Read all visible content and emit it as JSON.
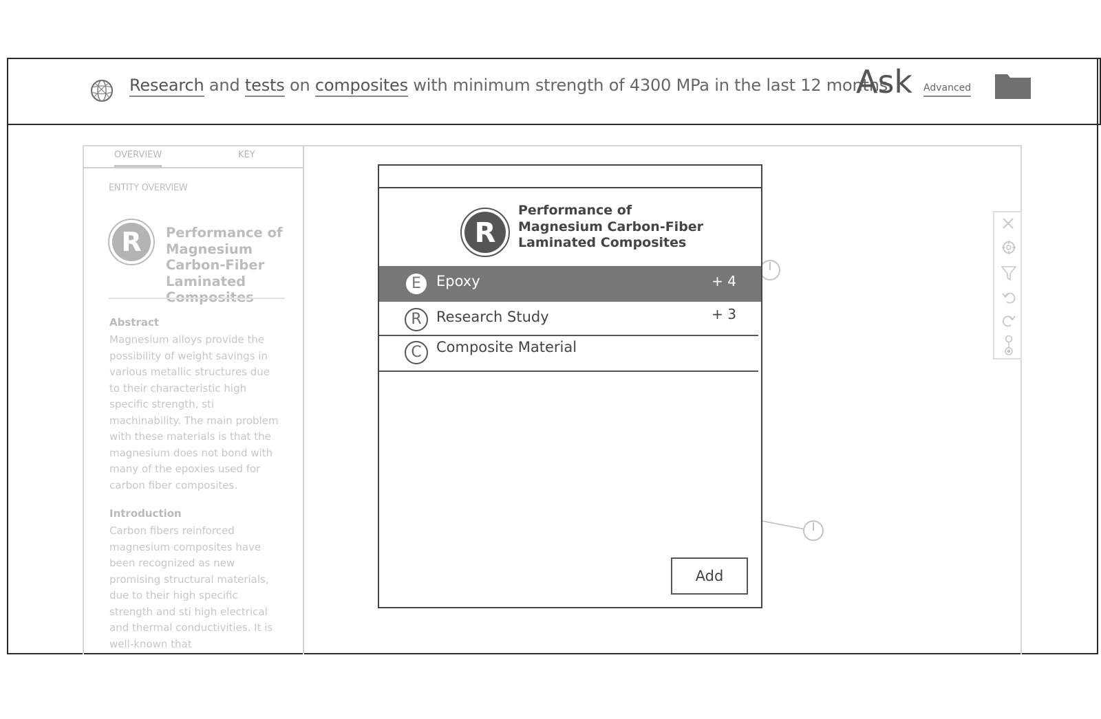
{
  "query": {
    "parts": [
      {
        "text": "Research",
        "keyword": true
      },
      {
        "text": " and ",
        "keyword": false
      },
      {
        "text": "tests",
        "keyword": true
      },
      {
        "text": " on ",
        "keyword": false
      },
      {
        "text": "composites",
        "keyword": true
      },
      {
        "text": " with minimum strength of 4300 MPa in the last 12 months",
        "keyword": false
      }
    ],
    "ask_label": "Ask",
    "advanced_label": "Advanced"
  },
  "left_panel": {
    "tabs": [
      "OVERVIEW",
      "KEY"
    ],
    "section_label": "ENTITY OVERVIEW",
    "entity_letter": "R",
    "entity_title": "Performance of Magnesium Carbon-Fiber Laminated Composites",
    "abstract_heading": "Abstract",
    "abstract_text": "Magnesium alloys provide the possibility of weight savings in various metallic structures due to their characteristic high specific strength, sti machinability.  The main problem with these materials is that the magnesium does not bond with many of the epoxies used for carbon fiber composites.",
    "intro_heading": "Introduction",
    "intro_text": "Carbon fibers reinforced magnesium composites have been recognized as new promising structural materials, due to their high specific strength and sti high electrical and thermal conductivities. It is well-known that"
  },
  "dialog": {
    "entity_letter": "R",
    "title": "Performance of  Magnesium Carbon-Fiber Laminated Composites",
    "rows": [
      {
        "letter": "E",
        "label": "Epoxy",
        "count": "+ 4",
        "selected": true
      },
      {
        "letter": "R",
        "label": "Research Study",
        "count": "+ 3",
        "selected": false
      },
      {
        "letter": "C",
        "label": "Composite Material",
        "count": "",
        "selected": false
      }
    ],
    "add_label": "Add"
  },
  "colors": {
    "selected_row": "#777777",
    "frame": "#2a2a2a",
    "faded_text": "#c2c2c2"
  },
  "toolbox_icons": [
    "close-icon",
    "crosshair-icon",
    "filter-icon",
    "undo-icon",
    "redo-icon",
    "path-icon"
  ]
}
